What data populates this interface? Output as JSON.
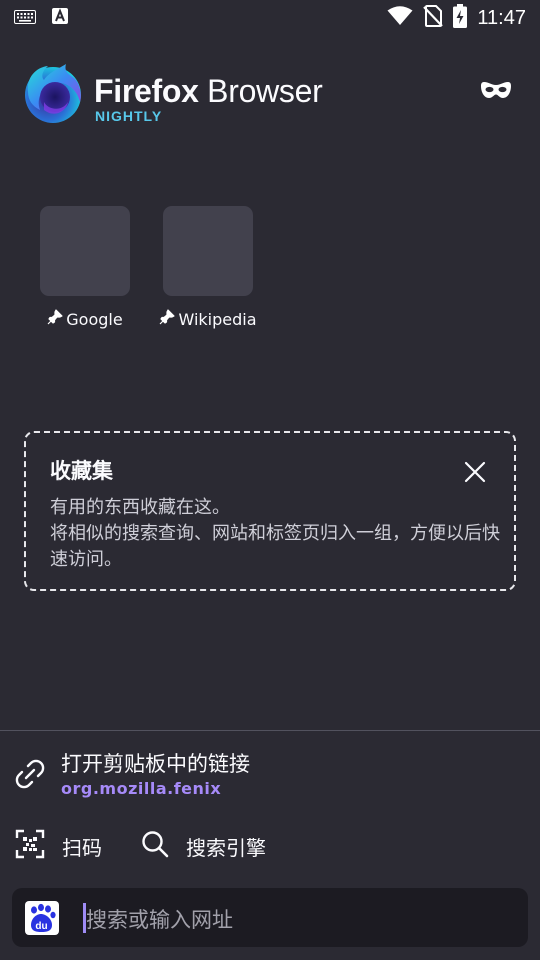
{
  "status_bar": {
    "time": "11:47",
    "icons": [
      "keyboard-icon",
      "a-notification-icon",
      "wifi-icon",
      "no-sim-icon",
      "battery-charging-icon"
    ]
  },
  "header": {
    "brand_bold": "Firefox",
    "brand_rest": " Browser",
    "subtitle": "NIGHTLY",
    "private_icon": "private-mask-icon"
  },
  "top_sites": [
    {
      "label": "Google",
      "icon": "pin-icon"
    },
    {
      "label": "Wikipedia",
      "icon": "pin-icon"
    }
  ],
  "collections": {
    "title": "收藏集",
    "body_line1": "有用的东西收藏在这。",
    "body_line2": "将相似的搜索查询、网站和标签页归入一组，方便以后快速访问。",
    "close_icon": "close-icon"
  },
  "clipboard": {
    "title": "打开剪贴板中的链接",
    "url": "org.mozilla.fenix"
  },
  "actions": {
    "scan_label": "扫码",
    "search_engine_label": "搜索引擎"
  },
  "urlbar": {
    "placeholder": "搜索或输入网址",
    "engine_icon": "baidu-icon"
  },
  "colors": {
    "background": "#2b2a33",
    "tile": "#42414d",
    "accent_purple": "#a68af9",
    "urlbar_bg": "#1c1b22"
  }
}
